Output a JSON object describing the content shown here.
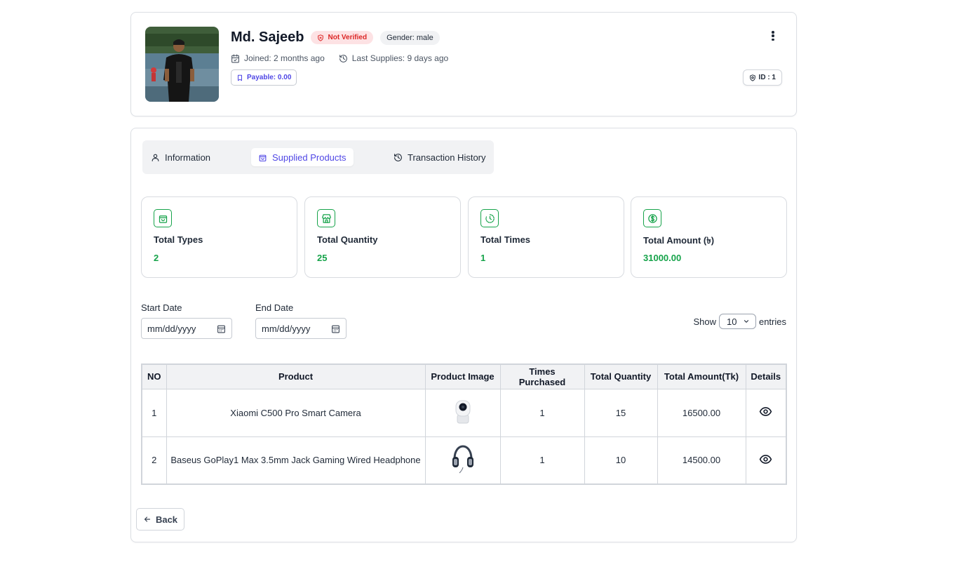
{
  "profile": {
    "name": "Md. Sajeeb",
    "verification_badge": "Not Verified",
    "gender_badge": "Gender: male",
    "joined": "Joined: 2 months ago",
    "last_supplies": "Last Supplies: 9 days ago",
    "payable": "Payable: 0.00",
    "id_badge": "ID : 1"
  },
  "tabs": [
    {
      "label": "Information",
      "icon": "user-icon",
      "active": false
    },
    {
      "label": "Supplied Products",
      "icon": "shopping-bag-icon",
      "active": true
    },
    {
      "label": "Transaction History",
      "icon": "history-icon",
      "active": false
    }
  ],
  "stats": [
    {
      "label": "Total Types",
      "value": "2",
      "icon": "shopping-bag-icon"
    },
    {
      "label": "Total Quantity",
      "value": "25",
      "icon": "store-icon"
    },
    {
      "label": "Total Times",
      "value": "1",
      "icon": "clock-icon"
    },
    {
      "label": "Total Amount (৳)",
      "value": "31000.00",
      "icon": "dollar-circle-icon"
    }
  ],
  "filters": {
    "start_date_label": "Start Date",
    "start_date_placeholder": "mm/dd/yyyy",
    "end_date_label": "End Date",
    "end_date_placeholder": "mm/dd/yyyy",
    "show_label": "Show",
    "show_value": "10",
    "entries_label": "entries"
  },
  "table": {
    "headers": [
      "NO",
      "Product",
      "Product Image",
      "Times Purchased",
      "Total Quantity",
      "Total Amount(Tk)",
      "Details"
    ],
    "rows": [
      {
        "no": "1",
        "product": "Xiaomi C500 Pro Smart Camera",
        "image": "camera",
        "times": "1",
        "quantity": "15",
        "amount": "16500.00"
      },
      {
        "no": "2",
        "product": "Baseus GoPlay1 Max 3.5mm Jack Gaming Wired Headphone",
        "image": "headphone",
        "times": "1",
        "quantity": "10",
        "amount": "14500.00"
      }
    ]
  },
  "back_label": "Back",
  "colors": {
    "accent": "#4f46e5",
    "success": "#16a34a",
    "danger": "#dc2626"
  }
}
